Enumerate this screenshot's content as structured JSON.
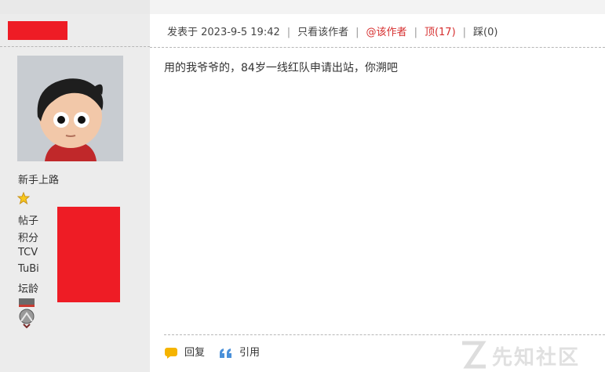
{
  "post": {
    "posted_at": "发表于 2023-9-5 19:42",
    "only_author": "只看该作者",
    "at_author": "@该作者",
    "upvote": "顶(17)",
    "downvote": "踩(0)",
    "content": "用的我爷爷的，84岁一线红队申请出站，你溯吧",
    "reply_label": "回复",
    "quote_label": "引用"
  },
  "author": {
    "rank": "新手上路",
    "stats": [
      "帖子",
      "积分",
      "TCV",
      "TuBi",
      "坛龄"
    ]
  },
  "watermark": "先知社区",
  "colors": {
    "redact": "#ee1c25",
    "accent_red": "#d62f2f",
    "sidebar_bg": "#ececec"
  }
}
